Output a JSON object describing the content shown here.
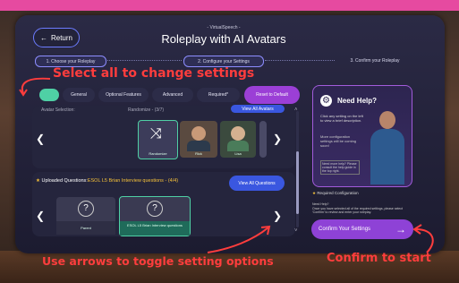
{
  "header": {
    "back_label": "Return",
    "subtitle": "- VirtualSpeech -",
    "title": "Roleplay with AI Avatars"
  },
  "steps": [
    {
      "label": "1. Choose your Roleplay"
    },
    {
      "label": "2. Configure your Settings"
    },
    {
      "label": "3. Confirm your Roleplay"
    }
  ],
  "tabs": [
    {
      "label": ""
    },
    {
      "label": "General"
    },
    {
      "label": "Optional Features"
    },
    {
      "label": "Advanced"
    },
    {
      "label": "Required*"
    }
  ],
  "reset_label": "Reset to Default",
  "avatar_section": {
    "label": "Avatar Selection:",
    "value": "Randomize - (3/7)",
    "view_button": "View All Avatars",
    "cards": [
      {
        "label": "Randomize"
      },
      {
        "label": "Rick"
      },
      {
        "label": "Lisa"
      }
    ]
  },
  "questions_section": {
    "label": "Uploaded Questions:",
    "value": "ESOL L5 Brian Interview questions - (4/4)",
    "view_button": "View All Questions",
    "cards": [
      {
        "label": "Parent"
      },
      {
        "label": "ESOL L5 Brian Interview questions"
      }
    ]
  },
  "help": {
    "title": "Need Help?",
    "body": "Click any setting on the left to view a brief description.",
    "note": "More configuration settings will be coming soon!",
    "tip": "Need more help? Please consult the help guide in the top right."
  },
  "required_label": "Required Configuration",
  "need_help_bottom": "Need Help?\nOnce you have selected all of the required settings, please select 'Confirm' to review and enter your roleplay.",
  "confirm_label": "Confirm Your Settings",
  "annotations": {
    "select_all": "Select all to change settings",
    "arrows": "Use arrows to toggle setting options",
    "confirm": "Confirm to start"
  },
  "colors": {
    "accent": "#8e42d6",
    "annotation": "#ff3d3d",
    "topbar": "#e64aa0",
    "tab_selected": "#4fd0a5"
  }
}
